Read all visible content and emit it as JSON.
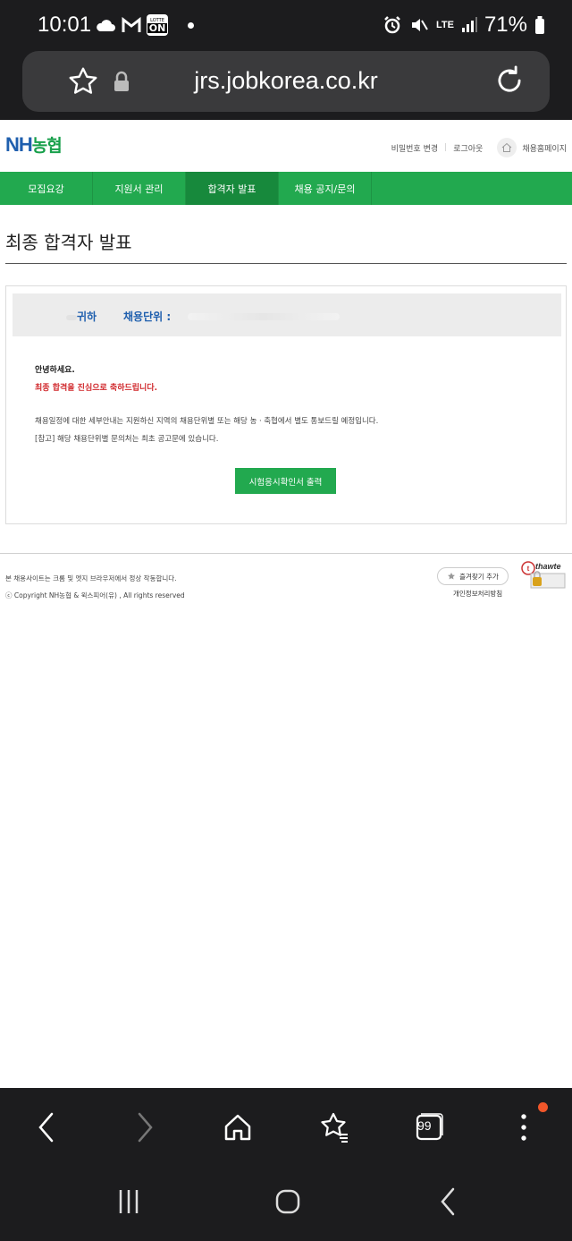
{
  "status_bar": {
    "time": "10:01",
    "battery": "71%",
    "network": "LTE",
    "lotte_badge_top": "LOTTE",
    "lotte_badge_bottom": "ON"
  },
  "url_bar": {
    "url": "jrs.jobkorea.co.kr"
  },
  "header": {
    "logo_nh": "NH",
    "logo_kr": "농협",
    "links": [
      "비밀번호 변경",
      "로그아웃"
    ],
    "home_link": "채용홈페이지"
  },
  "gnb": {
    "items": [
      {
        "label": "모집요강",
        "active": false
      },
      {
        "label": "지원서 관리",
        "active": false
      },
      {
        "label": "합격자 발표",
        "active": true
      },
      {
        "label": "채용 공지/문의",
        "active": false
      }
    ]
  },
  "main": {
    "title": "최종 합격자 발표",
    "honor_label": "귀하",
    "unit_label": "채용단위 :",
    "greeting": "안녕하세요.",
    "congrats": "최종 합격을 진심으로 축하드립니다.",
    "info_line1": "채용일정에 대한 세부안내는 지원하신 지역의 채용단위별 또는 해당 농ㆍ축협에서 별도 통보드릴 예정입니다.",
    "info_line2": "[참고] 해당 채용단위별 문의처는 최초 공고문에 있습니다.",
    "print_button": "시험응시확인서 출력"
  },
  "footer": {
    "notice": "본 채용사이트는 크롬 및 엣지 브라우저에서 정상 작동합니다.",
    "copyright": "ⓒ Copyright NH농협 & 윅스피어(유) , All rights reserved",
    "fav_button": "즐겨찾기 추가",
    "privacy": "개인정보처리방침",
    "cert_brand": "thawte"
  },
  "browser_toolbar": {
    "tab_count": "99",
    "icons": [
      "back-icon",
      "forward-icon",
      "home-icon",
      "bookmarks-icon",
      "tabs-icon",
      "menu-icon"
    ]
  },
  "colors": {
    "brand_green": "#22a94f",
    "brand_blue": "#1f5fae",
    "alert_red": "#d0272b",
    "chrome_dark": "#1c1c1e"
  }
}
